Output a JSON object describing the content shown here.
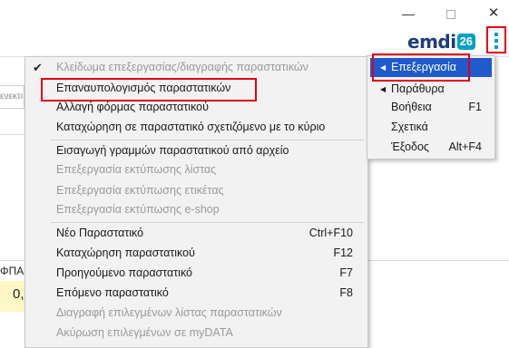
{
  "window": {
    "minimize": "—",
    "close": "✕"
  },
  "logo": {
    "text": "emdi",
    "badge": "26"
  },
  "background": {
    "field_fragment": "ενεκτι",
    "fpa_label": "ΦΠΑ",
    "value_fragment": "0,"
  },
  "menu": {
    "items": [
      {
        "label": "Κλείδωμα επεξεργασίας/διαγραφής παραστατικών",
        "shortcut": "",
        "disabled": true,
        "checked": true
      },
      {
        "label": "Επαναυπολογισμός παραστατικών",
        "shortcut": "",
        "disabled": false
      },
      {
        "label": "Αλλαγή φόρμας παραστατικού",
        "shortcut": "",
        "disabled": false
      },
      {
        "label": "Καταχώρηση σε παραστατικό σχετιζόμενο με το κύριο",
        "shortcut": "",
        "disabled": false
      },
      {
        "label": "Εισαγωγή γραμμών παραστατικού από αρχείο",
        "shortcut": "",
        "disabled": false
      },
      {
        "label": "Επεξεργασία εκτύπωσης λίστας",
        "shortcut": "",
        "disabled": true
      },
      {
        "label": "Επεξεργασία εκτύπωσης ετικέτας",
        "shortcut": "",
        "disabled": true
      },
      {
        "label": "Επεξεργασία εκτύπωσης e-shop",
        "shortcut": "",
        "disabled": true
      },
      {
        "label": "Νέο Παραστατικό",
        "shortcut": "Ctrl+F10",
        "disabled": false
      },
      {
        "label": "Καταχώρηση παραστατικού",
        "shortcut": "F12",
        "disabled": false
      },
      {
        "label": "Προηγούμενο παραστατικό",
        "shortcut": "F7",
        "disabled": false
      },
      {
        "label": "Επόμενο παραστατικό",
        "shortcut": "F8",
        "disabled": false
      },
      {
        "label": "Διαγραφή επιλεγμένων λίστας παραστατικών",
        "shortcut": "",
        "disabled": true
      },
      {
        "label": "Ακύρωση επιλεγμένων σε myDATA",
        "shortcut": "",
        "disabled": true
      }
    ]
  },
  "submenu": {
    "items": [
      {
        "label": "Επεξεργασία",
        "shortcut": "",
        "active": true,
        "has_arrow": true
      },
      {
        "label": "Παράθυρα",
        "shortcut": "",
        "active": false,
        "has_arrow": true
      },
      {
        "label": "Βοήθεια",
        "shortcut": "F1",
        "active": false,
        "has_arrow": false
      },
      {
        "label": "Σχετικά",
        "shortcut": "",
        "active": false,
        "has_arrow": false
      },
      {
        "label": "Έξοδος",
        "shortcut": "Alt+F4",
        "active": false,
        "has_arrow": false
      }
    ]
  },
  "colors": {
    "highlight_box": "#e0001b",
    "active_item": "#1f5bcc",
    "logo_dark": "#1e3c7d",
    "logo_accent": "#00a0c6"
  },
  "icons": {
    "check": "check-icon",
    "submenu_arrow": "triangle-left-icon",
    "kebab": "kebab-menu-icon"
  }
}
